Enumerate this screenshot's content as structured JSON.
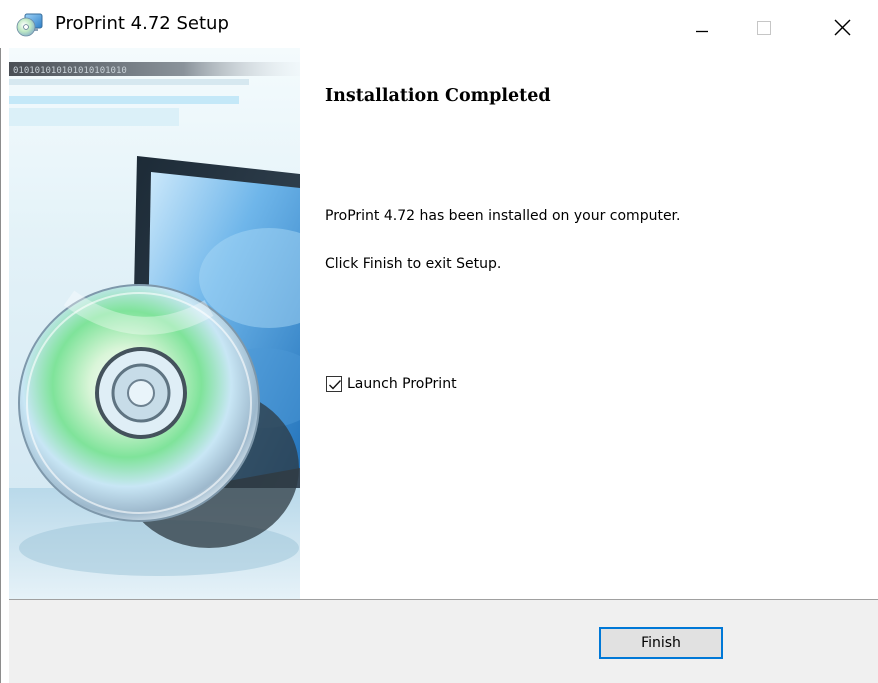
{
  "window": {
    "title": "ProPrint 4.72 Setup",
    "controls": {
      "minimize_icon": "minimize-icon",
      "maximize_icon": "maximize-icon",
      "close_icon": "close-icon"
    }
  },
  "banner": {
    "binary_strip": "010101010101010101010",
    "image_icon": "cd-monitor-illustration"
  },
  "content": {
    "heading": "Installation Completed",
    "message_installed": "ProPrint 4.72 has been installed on your computer.",
    "message_finish": "Click Finish to exit Setup.",
    "launch_checkbox": {
      "label": "Launch ProPrint",
      "checked": true
    }
  },
  "footer": {
    "finish_label": "Finish"
  },
  "colors": {
    "accent": "#0078d7",
    "footer_bg": "#f0f0f0",
    "button_bg": "#e1e1e1"
  }
}
